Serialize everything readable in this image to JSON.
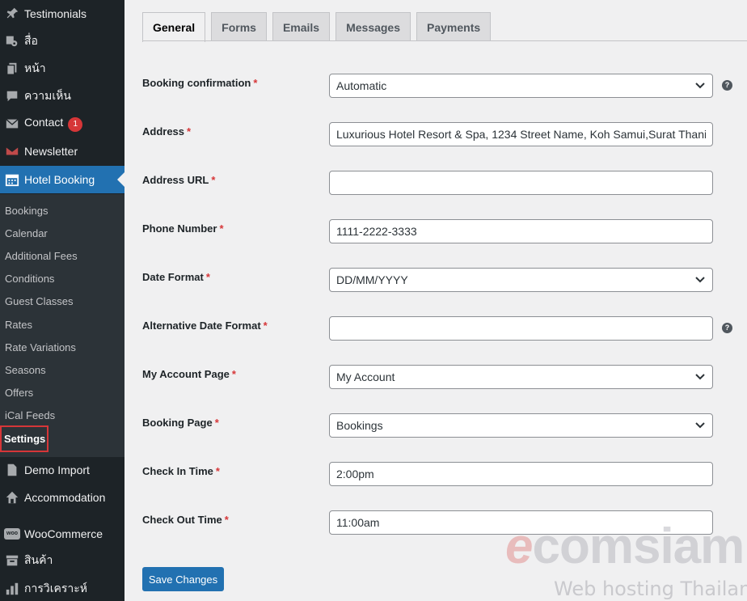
{
  "sidebar": {
    "top_items": [
      {
        "label": "Testimonials",
        "icon": "pin-icon"
      },
      {
        "label": "สื่อ",
        "icon": "media-icon"
      },
      {
        "label": "หน้า",
        "icon": "pages-icon"
      },
      {
        "label": "ความเห็น",
        "icon": "comments-icon"
      },
      {
        "label": "Contact",
        "icon": "mail-icon",
        "badge": "1"
      },
      {
        "label": "Newsletter",
        "icon": "newsletter-icon"
      },
      {
        "label": "Hotel Booking",
        "icon": "calendar-icon"
      }
    ],
    "submenu": [
      "Bookings",
      "Calendar",
      "Additional Fees",
      "Conditions",
      "Guest Classes",
      "Rates",
      "Rate Variations",
      "Seasons",
      "Offers",
      "iCal Feeds",
      "Settings"
    ],
    "bottom_items": [
      {
        "label": "Demo Import",
        "icon": "document-icon"
      },
      {
        "label": "Accommodation",
        "icon": "home-icon"
      },
      {
        "label": "WooCommerce",
        "icon": "woocommerce-icon",
        "icon_text": "woo"
      },
      {
        "label": "สินค้า",
        "icon": "archive-icon"
      },
      {
        "label": "การวิเคราะห์",
        "icon": "analytics-icon"
      }
    ]
  },
  "tabs": [
    "General",
    "Forms",
    "Emails",
    "Messages",
    "Payments"
  ],
  "form": {
    "fields": [
      {
        "label": "Booking confirmation",
        "type": "select",
        "value": "Automatic",
        "help": true
      },
      {
        "label": "Address",
        "type": "text",
        "value": "Luxurious Hotel Resort & Spa, 1234 Street Name, Koh Samui,Surat Thani, T"
      },
      {
        "label": "Address URL",
        "type": "text",
        "value": ""
      },
      {
        "label": "Phone Number",
        "type": "text",
        "value": "1111-2222-3333"
      },
      {
        "label": "Date Format",
        "type": "select",
        "value": "DD/MM/YYYY"
      },
      {
        "label": "Alternative Date Format",
        "type": "text",
        "value": "",
        "help": true
      },
      {
        "label": "My Account Page",
        "type": "select",
        "value": "My Account"
      },
      {
        "label": "Booking Page",
        "type": "select",
        "value": "Bookings"
      },
      {
        "label": "Check In Time",
        "type": "text",
        "value": "2:00pm"
      },
      {
        "label": "Check Out Time",
        "type": "text",
        "value": "11:00am"
      }
    ],
    "required_mark": "*",
    "help_icon": "?",
    "save_label": "Save Changes"
  },
  "watermark": {
    "brand_e": "e",
    "brand_rest": "comsiam",
    "tagline": "Web hosting Thailand"
  },
  "colors": {
    "sidebar_bg": "#1d2327",
    "accent": "#2271b1",
    "required": "#d63638"
  }
}
